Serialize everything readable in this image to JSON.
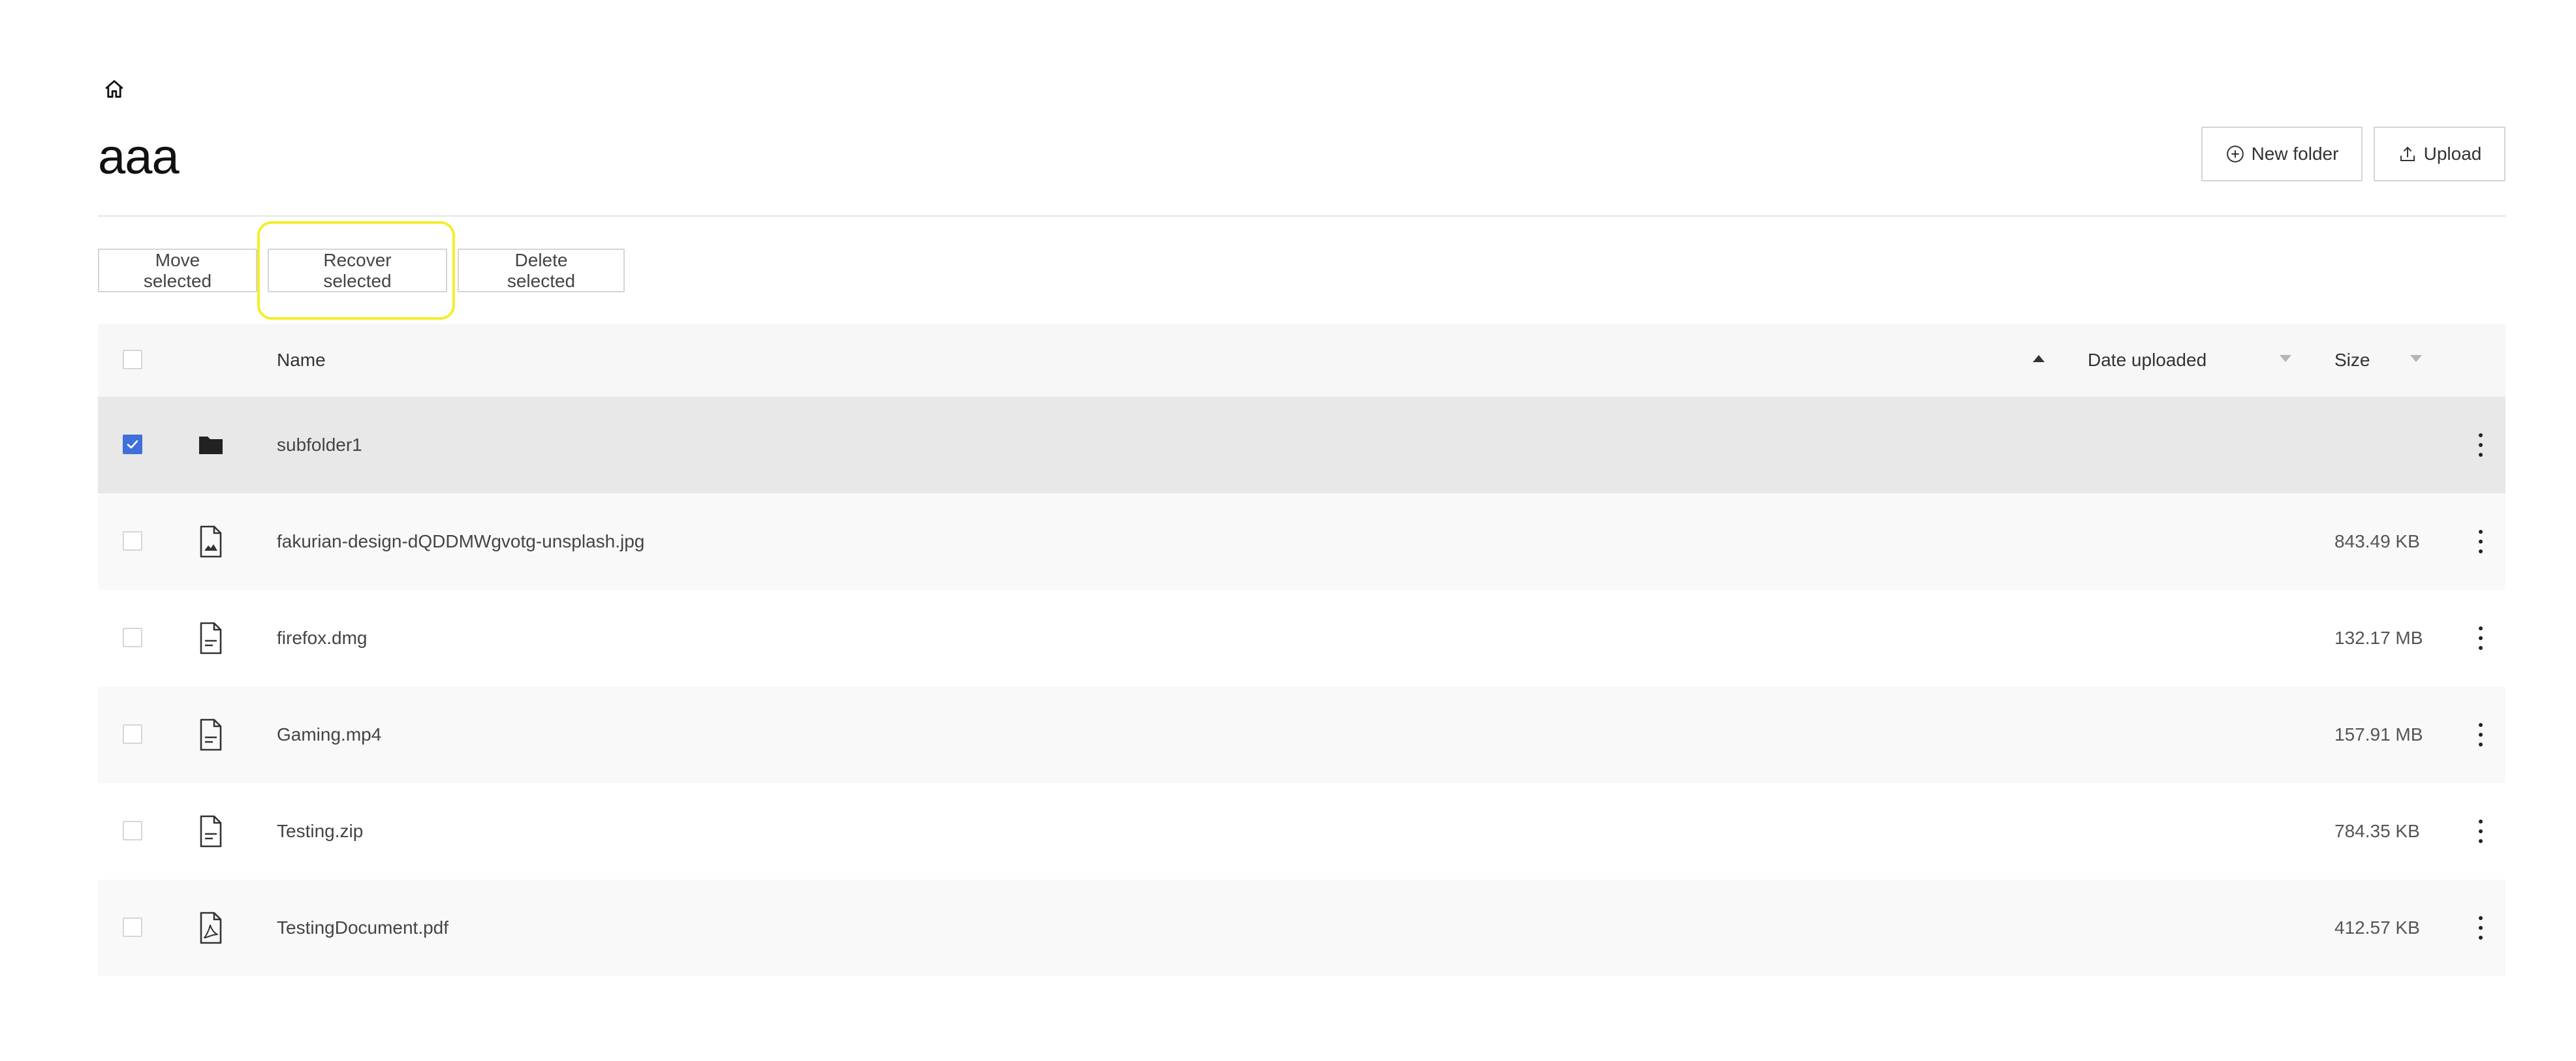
{
  "breadcrumb": {
    "home_icon": "home-icon"
  },
  "page": {
    "title": "aaa"
  },
  "header_actions": {
    "new_folder": {
      "label": "New folder",
      "icon": "plus-circle-icon"
    },
    "upload": {
      "label": "Upload",
      "icon": "upload-icon"
    }
  },
  "bulk_actions": {
    "move": "Move selected",
    "recover": "Recover selected",
    "delete": "Delete selected"
  },
  "colors": {
    "accent": "#3f6fd8",
    "highlight": "#f3ee2c",
    "selected_row": "#e8e8e8"
  },
  "table": {
    "columns": {
      "name": "Name",
      "date_uploaded": "Date uploaded",
      "size": "Size"
    },
    "sort": {
      "name": "ascending",
      "date_uploaded": "none",
      "size": "none"
    },
    "rows": [
      {
        "name": "subfolder1",
        "size": "",
        "type": "folder",
        "icon": "folder-icon",
        "selected": true
      },
      {
        "name": "fakurian-design-dQDDMWgvotg-unsplash.jpg",
        "size": "843.49 KB",
        "type": "image",
        "icon": "image-file-icon",
        "selected": false
      },
      {
        "name": "firefox.dmg",
        "size": "132.17 MB",
        "type": "file",
        "icon": "text-file-icon",
        "selected": false
      },
      {
        "name": "Gaming.mp4",
        "size": "157.91 MB",
        "type": "file",
        "icon": "text-file-icon",
        "selected": false
      },
      {
        "name": "Testing.zip",
        "size": "784.35 KB",
        "type": "file",
        "icon": "text-file-icon",
        "selected": false
      },
      {
        "name": "TestingDocument.pdf",
        "size": "412.57 KB",
        "type": "pdf",
        "icon": "pdf-file-icon",
        "selected": false
      }
    ]
  }
}
